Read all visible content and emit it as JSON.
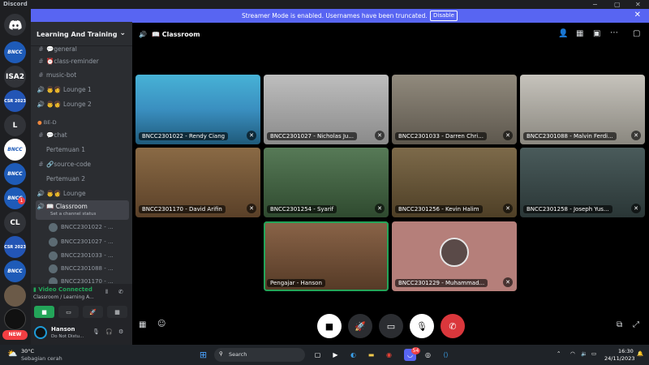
{
  "window": {
    "app_name": "Discord",
    "controls": {
      "minimize": "−",
      "maximize": "▢",
      "close": "✕"
    }
  },
  "banner": {
    "message": "Streamer Mode is enabled. Usernames have been truncated.",
    "button": "Disable",
    "close": "✕"
  },
  "guilds": [
    {
      "label": "BNCC",
      "type": "bncc"
    },
    {
      "label": "ISA2",
      "type": "letter"
    },
    {
      "label": "CSR 2023",
      "type": "csr"
    },
    {
      "label": "L",
      "type": "letter"
    },
    {
      "label": "BNCC",
      "type": "bncc"
    },
    {
      "label": "BNCC",
      "type": "bncc"
    },
    {
      "label": "BNCC",
      "type": "bncc"
    },
    {
      "label": "CL",
      "type": "letter"
    },
    {
      "label": "CSR 2023",
      "type": "csr"
    },
    {
      "label": "BNCC",
      "type": "bncc"
    }
  ],
  "guild_badges": {
    "b1": "1",
    "new": "NEW"
  },
  "server": {
    "name": "Learning And Training",
    "chevron": "⌄"
  },
  "channels": [
    {
      "icon": "#",
      "label": "💬general"
    },
    {
      "icon": "#",
      "label": "⏰class-reminder"
    },
    {
      "icon": "#",
      "label": "music-bot"
    },
    {
      "icon": "🔊",
      "label": "👨‍👩 Lounge 1"
    },
    {
      "icon": "🔊",
      "label": "👨‍👩 Lounge 2"
    }
  ],
  "category": "BE-D",
  "channels2": [
    {
      "icon": "#",
      "label": "💬chat"
    },
    {
      "icon": "",
      "label": "Pertemuan 1"
    },
    {
      "icon": "#",
      "label": "🔗source-code"
    },
    {
      "icon": "",
      "label": "Pertemuan 2"
    },
    {
      "icon": "🔊",
      "label": "👨‍👩 Lounge"
    }
  ],
  "active_channel": {
    "icon": "🔊",
    "label": "📖 Classroom",
    "status": "Set a channel status"
  },
  "voice_users": [
    "BNCC2301022 - ...",
    "BNCC2301027 - ...",
    "BNCC2301033 - ...",
    "BNCC2301088 - ...",
    "BNCC2301170 - ..."
  ],
  "voice_panel": {
    "status": "Video Connected",
    "location": "Classroom / Learning A..."
  },
  "user": {
    "name": "Hanson",
    "status": "Do Not Distu..."
  },
  "stage": {
    "title": "📖 Classroom"
  },
  "participants": [
    {
      "label": "BNCC2301022 - Rendy Ciang",
      "color": "#3fa0c4"
    },
    {
      "label": "BNCC2301027 - Nicholas Ju...",
      "color": "#a8a8a8"
    },
    {
      "label": "BNCC2301033 - Darren Chri...",
      "color": "#7d7569"
    },
    {
      "label": "BNCC2301088 - Malvin Ferdi...",
      "color": "#b1aea7"
    },
    {
      "label": "BNCC2301170 - David Arifin",
      "color": "#7a5b3a"
    },
    {
      "label": "BNCC2301254 - Syarif",
      "color": "#3f6a3f"
    },
    {
      "label": "BNCC2301256 - Kevin Halim",
      "color": "#6d5a3a"
    },
    {
      "label": "BNCC2301258 - Joseph Yus...",
      "color": "#3a4a4a"
    },
    {
      "label": "Pengajar - Hanson",
      "color": "#7a5438"
    },
    {
      "label": "BNCC2301229 - Muhammad...",
      "color": "#b57f7a"
    }
  ],
  "weather": {
    "temp": "30°C",
    "desc": "Sebagian cerah"
  },
  "search": {
    "placeholder": "Search"
  },
  "clock": {
    "time": "16:30",
    "date": "24/11/2023"
  },
  "taskbar_badge": "54"
}
